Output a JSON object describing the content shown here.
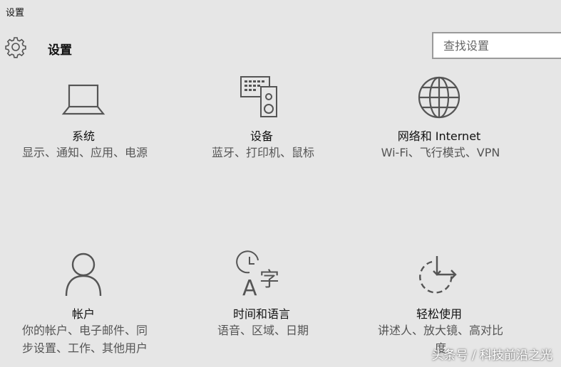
{
  "window": {
    "title": "设置"
  },
  "header": {
    "title": "设置",
    "search_placeholder": "查找设置"
  },
  "tiles": [
    {
      "name": "系统",
      "desc": "显示、通知、应用、电源",
      "icon": "laptop-icon"
    },
    {
      "name": "设备",
      "desc": "蓝牙、打印机、鼠标",
      "icon": "devices-icon"
    },
    {
      "name": "网络和 Internet",
      "desc": "Wi-Fi、飞行模式、VPN",
      "icon": "globe-icon"
    },
    {
      "name": "帐户",
      "desc": "你的帐户、电子邮件、同步设置、工作、其他用户",
      "icon": "person-icon"
    },
    {
      "name": "时间和语言",
      "desc": "语音、区域、日期",
      "icon": "time-language-icon"
    },
    {
      "name": "轻松使用",
      "desc": "讲述人、放大镜、高对比度",
      "icon": "ease-of-access-icon"
    }
  ],
  "watermark": "头条号 / 科技前沿之光"
}
